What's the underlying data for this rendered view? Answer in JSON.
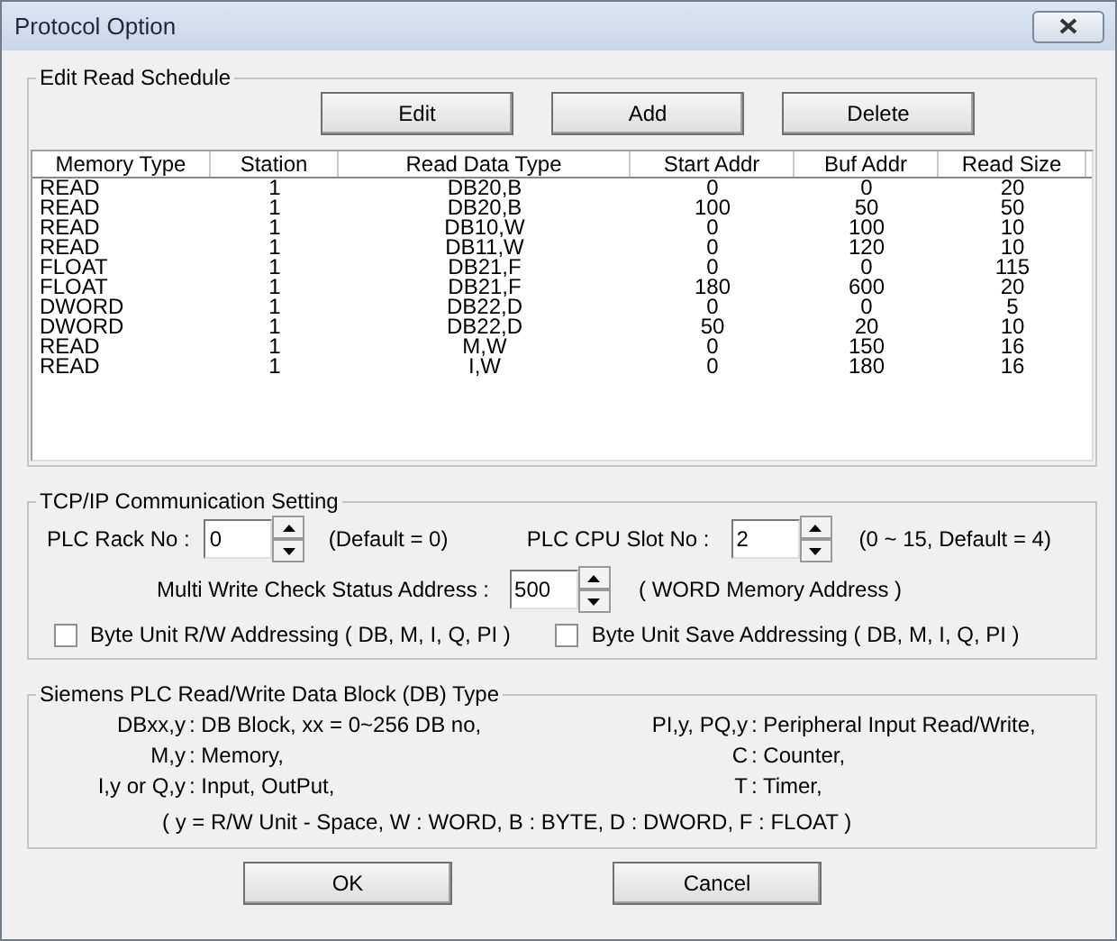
{
  "window": {
    "title": "Protocol Option"
  },
  "schedule": {
    "title": "Edit Read Schedule",
    "buttons": [
      "Edit",
      "Add",
      "Delete"
    ],
    "columns": [
      "Memory Type",
      "Station",
      "Read Data Type",
      "Start Addr",
      "Buf Addr",
      "Read Size"
    ],
    "rows": [
      [
        "READ",
        "1",
        "DB20,B",
        "0",
        "0",
        "20"
      ],
      [
        "READ",
        "1",
        "DB20,B",
        "100",
        "50",
        "50"
      ],
      [
        "READ",
        "1",
        "DB10,W",
        "0",
        "100",
        "10"
      ],
      [
        "READ",
        "1",
        "DB11,W",
        "0",
        "120",
        "10"
      ],
      [
        "FLOAT",
        "1",
        "DB21,F",
        "0",
        "0",
        "115"
      ],
      [
        "FLOAT",
        "1",
        "DB21,F",
        "180",
        "600",
        "20"
      ],
      [
        "DWORD",
        "1",
        "DB22,D",
        "0",
        "0",
        "5"
      ],
      [
        "DWORD",
        "1",
        "DB22,D",
        "50",
        "20",
        "10"
      ],
      [
        "READ",
        "1",
        "M,W",
        "0",
        "150",
        "16"
      ],
      [
        "READ",
        "1",
        "I,W",
        "0",
        "180",
        "16"
      ]
    ]
  },
  "tcp": {
    "title": "TCP/IP Communication Setting",
    "rack": {
      "label": "PLC Rack No :",
      "value": "0",
      "hint": "(Default = 0)"
    },
    "slot": {
      "label": "PLC CPU Slot No :",
      "value": "2",
      "hint": "(0 ~ 15, Default = 4)"
    },
    "multi": {
      "label": "Multi Write Check Status Address :",
      "value": "500",
      "hint": "( WORD Memory Address )"
    },
    "checkboxes": [
      {
        "label": "Byte Unit R/W Addressing ( DB, M, I, Q, PI )",
        "checked": false
      },
      {
        "label": "Byte Unit Save Addressing ( DB, M, I, Q, PI )",
        "checked": false
      }
    ]
  },
  "siemens": {
    "title": "Siemens PLC Read/Write Data Block (DB) Type",
    "rows": [
      [
        {
          "key": "DBxx,y",
          "desc": ": DB Block,  xx = 0~256 DB no,"
        },
        {
          "key": "PI,y, PQ,y",
          "desc": ": Peripheral Input Read/Write,"
        }
      ],
      [
        {
          "key": "M,y",
          "desc": ": Memory,"
        },
        {
          "key": "C",
          "desc": ": Counter,"
        }
      ],
      [
        {
          "key": "I,y or Q,y",
          "desc": " : Input, OutPut,"
        },
        {
          "key": "T",
          "desc": ": Timer,"
        }
      ]
    ],
    "footer": "( y = R/W Unit - Space, W : WORD, B : BYTE, D : DWORD, F : FLOAT )"
  },
  "buttons": [
    "OK",
    "Cancel"
  ]
}
